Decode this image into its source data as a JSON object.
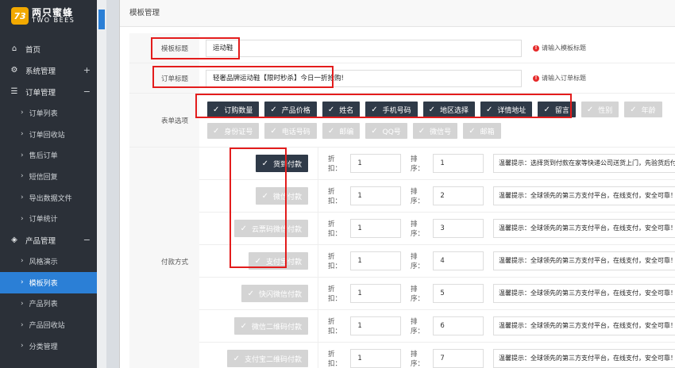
{
  "logo": {
    "badge": "73",
    "cn": "两只蜜蜂",
    "en": "TWO BEES"
  },
  "nav": {
    "home": "首页",
    "system": {
      "label": "系统管理",
      "toggle": "+"
    },
    "order": {
      "label": "订单管理",
      "toggle": "−"
    },
    "order_items": [
      "订单列表",
      "订单回收站",
      "售后订单",
      "短信回复",
      "导出数据文件",
      "订单统计"
    ],
    "product": {
      "label": "产品管理",
      "toggle": "−"
    },
    "product_items": [
      "风格演示",
      "模板列表",
      "产品列表",
      "产品回收站",
      "分类管理"
    ]
  },
  "panel": {
    "title": "模板管理"
  },
  "form": {
    "template_title": {
      "label": "模板标题",
      "value": "运动鞋",
      "hint": "请输入模板标题"
    },
    "order_title": {
      "label": "订单标题",
      "value": "轻奢品牌运动鞋【限时秒杀】今日一折抢购!",
      "hint": "请输入订单标题"
    },
    "form_options": {
      "label": "表单选项",
      "items": [
        {
          "text": "订购数量",
          "checked": true
        },
        {
          "text": "产品价格",
          "checked": true
        },
        {
          "text": "姓名",
          "checked": true
        },
        {
          "text": "手机号码",
          "checked": true
        },
        {
          "text": "地区选择",
          "checked": true
        },
        {
          "text": "详情地址",
          "checked": true
        },
        {
          "text": "留言",
          "checked": true
        },
        {
          "text": "性别",
          "checked": false
        },
        {
          "text": "年龄",
          "checked": false
        },
        {
          "text": "身份证号",
          "checked": false
        },
        {
          "text": "电话号码",
          "checked": false
        },
        {
          "text": "邮编",
          "checked": false
        },
        {
          "text": "QQ号",
          "checked": false
        },
        {
          "text": "微信号",
          "checked": false
        },
        {
          "text": "邮箱",
          "checked": false
        }
      ]
    },
    "payment": {
      "label": "付款方式",
      "discount_label": "折扣：",
      "order_label": "排序：",
      "methods": [
        {
          "name": "货到付款",
          "checked": true,
          "discount": "1",
          "order": "1",
          "tip": "温馨提示：选择货到付款在家等快递公司送货上门，先验货后付款！"
        },
        {
          "name": "微信付款",
          "checked": false,
          "discount": "1",
          "order": "2",
          "tip": "温馨提示：全球领先的第三方支付平台，在线支付，安全可靠！"
        },
        {
          "name": "云票码微信付款",
          "checked": false,
          "discount": "1",
          "order": "3",
          "tip": "温馨提示：全球领先的第三方支付平台，在线支付，安全可靠！"
        },
        {
          "name": "支付宝付款",
          "checked": false,
          "discount": "1",
          "order": "4",
          "tip": "温馨提示：全球领先的第三方支付平台，在线支付，安全可靠！"
        },
        {
          "name": "快闪微信付款",
          "checked": false,
          "discount": "1",
          "order": "5",
          "tip": "温馨提示：全球领先的第三方支付平台，在线支付，安全可靠！"
        },
        {
          "name": "微信二维码付款",
          "checked": false,
          "discount": "1",
          "order": "6",
          "tip": "温馨提示：全球领先的第三方支付平台，在线支付，安全可靠！"
        },
        {
          "name": "支付宝二维码付款",
          "checked": false,
          "discount": "1",
          "order": "7",
          "tip": "温馨提示：全球领先的第三方支付平台，在线支付，安全可靠！"
        }
      ]
    }
  },
  "colors": {
    "sidebar": "#2b3038",
    "active": "#2b7fd6",
    "checked": "#2f3a48",
    "unchecked": "#d4d4d4",
    "highlight": "#e31c1c",
    "logo": "#f2a900"
  }
}
